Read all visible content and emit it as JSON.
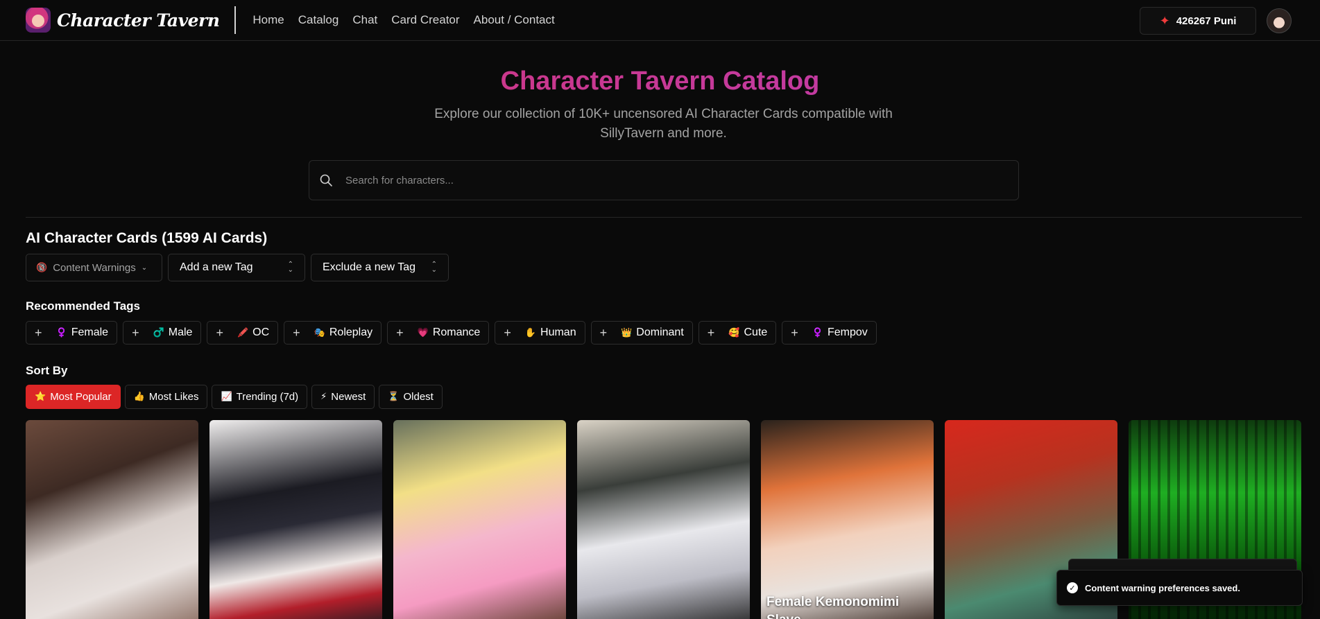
{
  "brand": {
    "name": "Character Tavern"
  },
  "nav": {
    "links": [
      "Home",
      "Catalog",
      "Chat",
      "Card Creator",
      "About / Contact"
    ]
  },
  "account": {
    "puni": "426267 Puni",
    "spark_icon": "sparkle-icon"
  },
  "hero": {
    "title": "Character Tavern Catalog",
    "subtitle": "Explore our collection of 10K+ uncensored AI Character Cards compatible with SillyTavern and more."
  },
  "search": {
    "placeholder": "Search for characters...",
    "value": ""
  },
  "cards_section": {
    "title": "AI Character Cards (1599 AI Cards)"
  },
  "filters": {
    "content_warnings": {
      "icon": "🔞",
      "label": "Content Warnings"
    },
    "add_tag": "Add a new Tag",
    "exclude_tag": "Exclude a new Tag"
  },
  "recommended": {
    "title": "Recommended Tags",
    "tags": [
      {
        "emoji": "♀️",
        "label": "Female"
      },
      {
        "emoji": "♂️",
        "label": "Male"
      },
      {
        "emoji": "🖍️",
        "label": "OC"
      },
      {
        "emoji": "🎭",
        "label": "Roleplay"
      },
      {
        "emoji": "💗",
        "label": "Romance"
      },
      {
        "emoji": "✋",
        "label": "Human"
      },
      {
        "emoji": "👑",
        "label": "Dominant"
      },
      {
        "emoji": "🥰",
        "label": "Cute"
      },
      {
        "emoji": "♀️",
        "label": "Fempov"
      }
    ]
  },
  "sort": {
    "title": "Sort By",
    "options": [
      {
        "emoji": "⭐",
        "label": "Most Popular",
        "active": true
      },
      {
        "emoji": "👍",
        "label": "Most Likes",
        "active": false
      },
      {
        "emoji": "📈",
        "label": "Trending (7d)",
        "active": false
      },
      {
        "emoji": "⚡",
        "label": "Newest",
        "active": false
      },
      {
        "emoji": "⏳",
        "label": "Oldest",
        "active": false
      }
    ]
  },
  "cards": [
    {
      "label": ""
    },
    {
      "label": ""
    },
    {
      "label": ""
    },
    {
      "label": ""
    },
    {
      "label": "Female Kemonomimi Slave"
    },
    {
      "label": ""
    },
    {
      "label": ""
    }
  ],
  "toast": {
    "message": "Content warning preferences saved."
  },
  "colors": {
    "accent": "#dc2626",
    "title_gradient_start": "#d6336c",
    "title_gradient_end": "#b73fc0"
  }
}
